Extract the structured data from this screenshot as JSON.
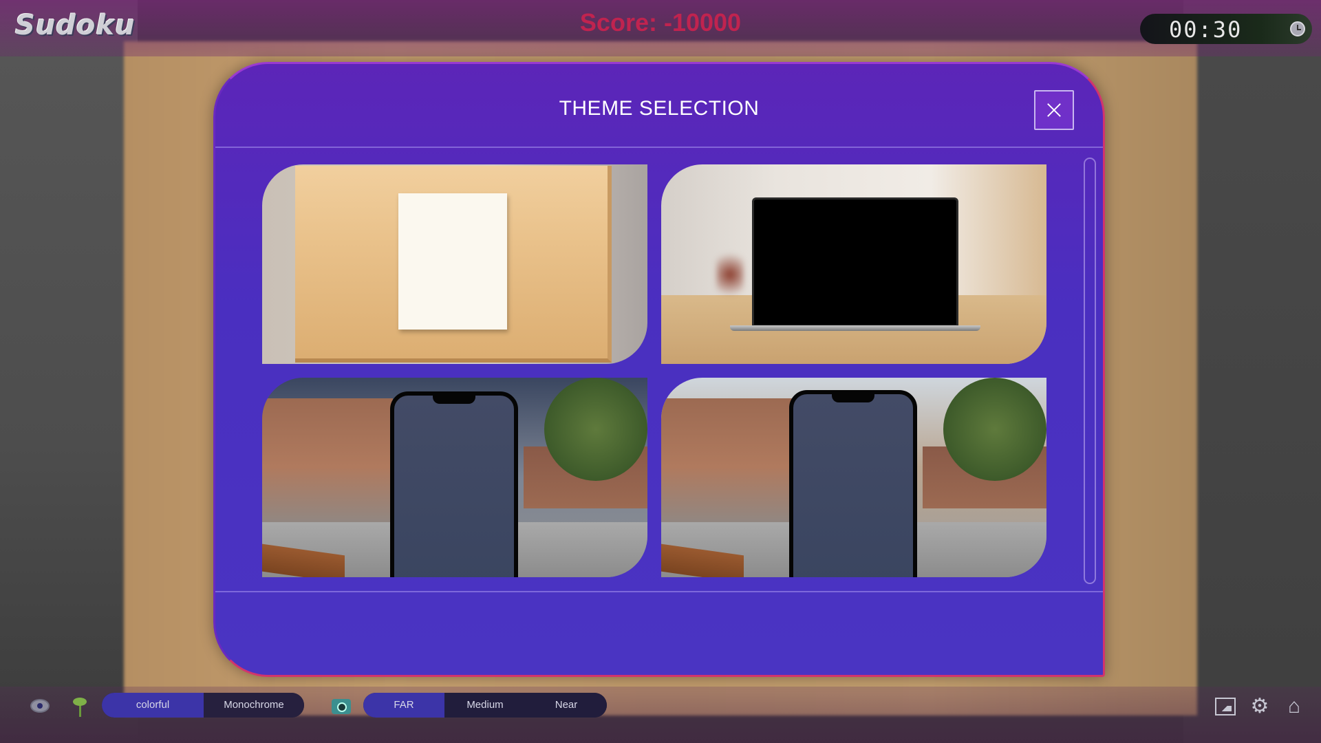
{
  "app": {
    "logo_text": "Sudoku"
  },
  "header": {
    "score": "Score: -10000",
    "timer": "00:30"
  },
  "modal": {
    "title": "THEME SELECTION",
    "themes": [
      {
        "icon": "wooden-board-paper"
      },
      {
        "icon": "laptop-desk"
      },
      {
        "icon": "phone-schoolyard-night"
      },
      {
        "icon": "phone-schoolyard-day"
      }
    ]
  },
  "bottom_bar": {
    "color_mode": {
      "options": [
        "colorful",
        "Monochrome"
      ],
      "selected": "colorful"
    },
    "distance": {
      "options": [
        "FAR",
        "Medium",
        "Near"
      ],
      "selected": "FAR"
    }
  },
  "colors": {
    "modal_bg": "#4a2fc0",
    "modal_border": "#d1346d",
    "score_text": "#c0234f",
    "selected_option": "#3c34a8"
  }
}
